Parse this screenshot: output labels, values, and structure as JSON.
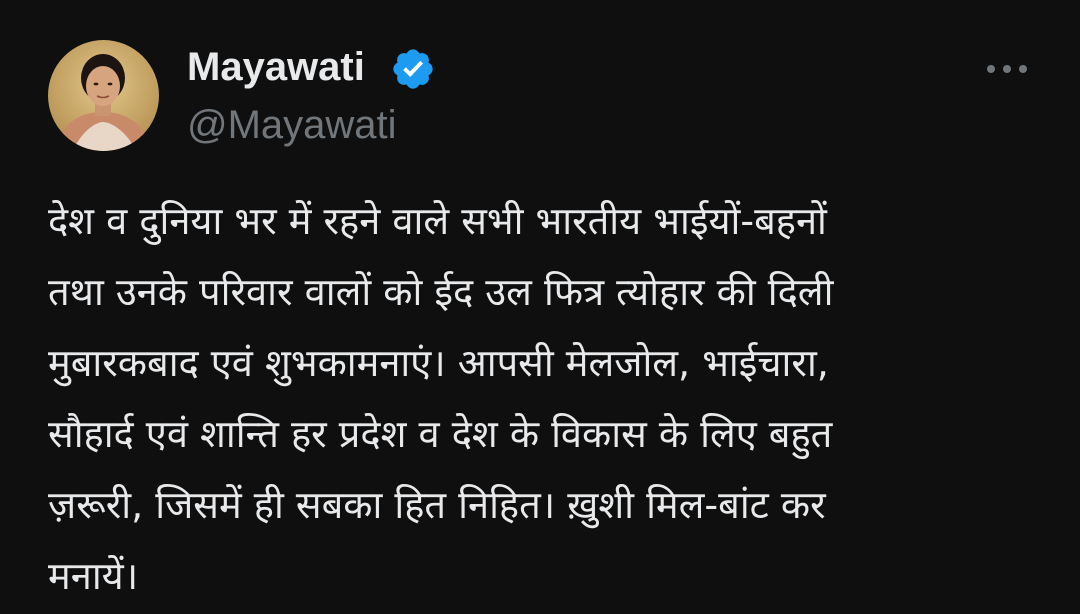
{
  "tweet": {
    "author": {
      "name": "Mayawati",
      "handle": "@Mayawati",
      "verified": true,
      "verified_color": "#1d9bf0"
    },
    "more_icon": "more-horizontal-icon",
    "text": "देश व दुनिया भर में रहने वाले सभी भारतीय भाईयों-बहनों\nतथा उनके परिवार वालों को ईद उल फित्र त्योहार की दिली\nमुबारकबाद एवं शुभकामनाएं। आपसी मेलजोल, भाईचारा,\nसौहार्द एवं शान्ति हर प्रदेश व देश के विकास के लिए बहुत\nज़रूरी, जिसमें ही सबका हित निहित। ख़ुशी मिल-बांट कर\nमनायें।"
  },
  "colors": {
    "background": "#0f0f10",
    "text_primary": "#e7e9ea",
    "text_secondary": "#71767b"
  }
}
